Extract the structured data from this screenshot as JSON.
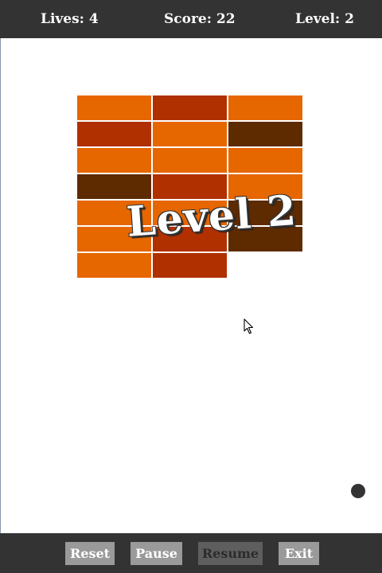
{
  "hud": {
    "lives_text": "Lives: 4",
    "score_text": "Score: 22",
    "level_text": "Level: 2"
  },
  "banner": {
    "text": "Level 2"
  },
  "bricks": {
    "columns": 3,
    "rows": [
      [
        "orange",
        "red",
        "orange"
      ],
      [
        "red",
        "orange",
        "brown"
      ],
      [
        "orange",
        "orange",
        "orange"
      ],
      [
        "brown",
        "red",
        "orange"
      ],
      [
        "orange",
        "orange",
        "brown"
      ],
      [
        "orange",
        "red",
        "brown"
      ],
      [
        "orange",
        "red",
        null
      ]
    ]
  },
  "colors": {
    "hud_background": "#333333",
    "brick_orange": "#e66600",
    "brick_red": "#b03000",
    "brick_brown": "#5e2a00",
    "paddle": "#333333",
    "ball": "#333333",
    "button": "#9a9a9a",
    "button_disabled": "#5e5e5e"
  },
  "controls": {
    "reset_label": "Reset",
    "pause_label": "Pause",
    "resume_label": "Resume",
    "exit_label": "Exit",
    "resume_enabled": false
  }
}
